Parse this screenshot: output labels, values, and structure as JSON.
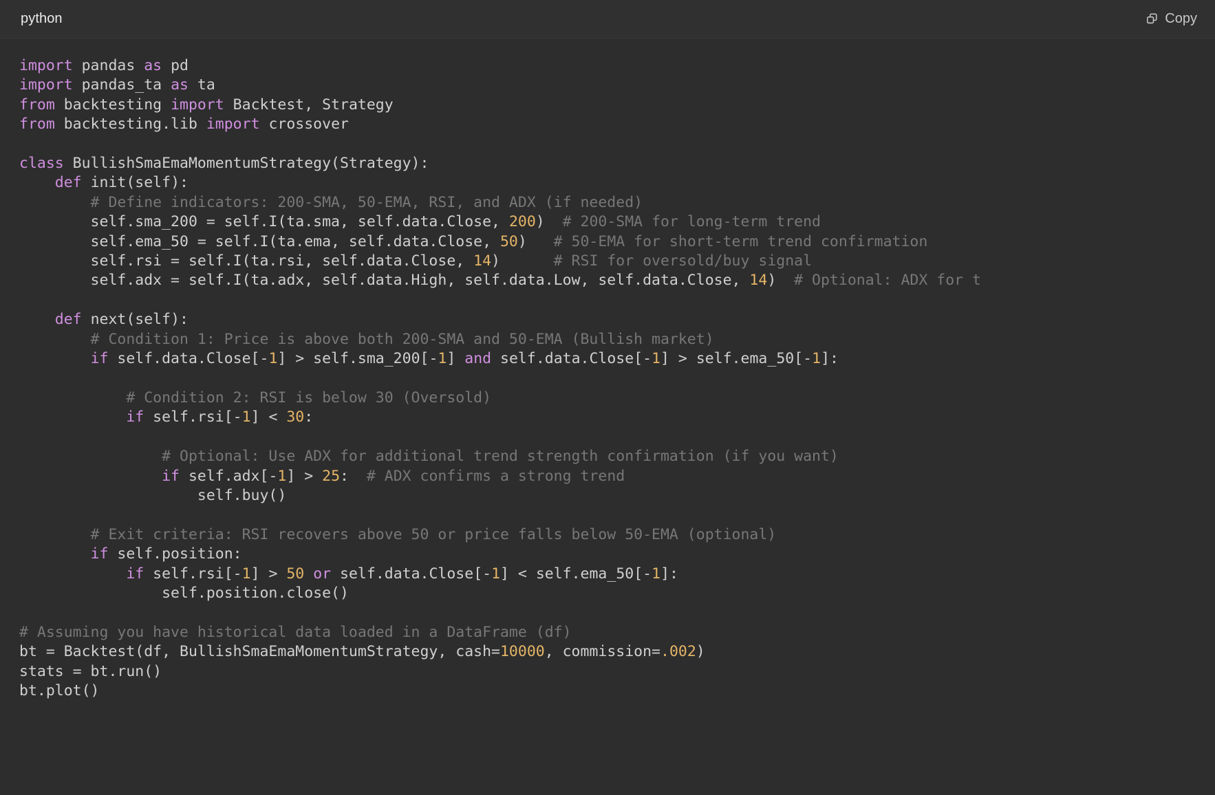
{
  "header": {
    "language_label": "python",
    "copy_label": "Copy",
    "copy_icon": "copy-icon"
  },
  "colors": {
    "background": "#2d2d2d",
    "header_background": "#303030",
    "keyword": "#d08fe0",
    "number": "#e5b567",
    "comment": "#777777",
    "identifier": "#d0d0d0",
    "label_text": "#ececec"
  },
  "code": {
    "language": "python",
    "lines": [
      [
        [
          "kw",
          "import"
        ],
        [
          "id",
          " pandas "
        ],
        [
          "kw",
          "as"
        ],
        [
          "id",
          " pd"
        ]
      ],
      [
        [
          "kw",
          "import"
        ],
        [
          "id",
          " pandas_ta "
        ],
        [
          "kw",
          "as"
        ],
        [
          "id",
          " ta"
        ]
      ],
      [
        [
          "kw",
          "from"
        ],
        [
          "id",
          " backtesting "
        ],
        [
          "kw",
          "import"
        ],
        [
          "id",
          " Backtest, Strategy"
        ]
      ],
      [
        [
          "kw",
          "from"
        ],
        [
          "id",
          " backtesting.lib "
        ],
        [
          "kw",
          "import"
        ],
        [
          "id",
          " crossover"
        ]
      ],
      [],
      [
        [
          "kw",
          "class"
        ],
        [
          "id",
          " BullishSmaEmaMomentumStrategy(Strategy):"
        ]
      ],
      [
        [
          "id",
          "    "
        ],
        [
          "kw",
          "def"
        ],
        [
          "id",
          " init(self):"
        ]
      ],
      [
        [
          "cm",
          "        # Define indicators: 200-SMA, 50-EMA, RSI, and ADX (if needed)"
        ]
      ],
      [
        [
          "id",
          "        self.sma_200 = self.I(ta.sma, self.data.Close, "
        ],
        [
          "num",
          "200"
        ],
        [
          "id",
          ")"
        ],
        [
          "cm",
          "  # 200-SMA for long-term trend"
        ]
      ],
      [
        [
          "id",
          "        self.ema_50 = self.I(ta.ema, self.data.Close, "
        ],
        [
          "num",
          "50"
        ],
        [
          "id",
          ")"
        ],
        [
          "cm",
          "   # 50-EMA for short-term trend confirmation"
        ]
      ],
      [
        [
          "id",
          "        self.rsi = self.I(ta.rsi, self.data.Close, "
        ],
        [
          "num",
          "14"
        ],
        [
          "id",
          ")"
        ],
        [
          "cm",
          "      # RSI for oversold/buy signal"
        ]
      ],
      [
        [
          "id",
          "        self.adx = self.I(ta.adx, self.data.High, self.data.Low, self.data.Close, "
        ],
        [
          "num",
          "14"
        ],
        [
          "id",
          ")"
        ],
        [
          "cm",
          "  # Optional: ADX for t"
        ]
      ],
      [],
      [
        [
          "id",
          "    "
        ],
        [
          "kw",
          "def"
        ],
        [
          "id",
          " next(self):"
        ]
      ],
      [
        [
          "cm",
          "        # Condition 1: Price is above both 200-SMA and 50-EMA (Bullish market)"
        ]
      ],
      [
        [
          "id",
          "        "
        ],
        [
          "kw",
          "if"
        ],
        [
          "id",
          " self.data.Close[-"
        ],
        [
          "num",
          "1"
        ],
        [
          "id",
          "] > self.sma_200[-"
        ],
        [
          "num",
          "1"
        ],
        [
          "id",
          "] "
        ],
        [
          "kw",
          "and"
        ],
        [
          "id",
          " self.data.Close[-"
        ],
        [
          "num",
          "1"
        ],
        [
          "id",
          "] > self.ema_50[-"
        ],
        [
          "num",
          "1"
        ],
        [
          "id",
          "]:"
        ]
      ],
      [],
      [
        [
          "cm",
          "            # Condition 2: RSI is below 30 (Oversold)"
        ]
      ],
      [
        [
          "id",
          "            "
        ],
        [
          "kw",
          "if"
        ],
        [
          "id",
          " self.rsi[-"
        ],
        [
          "num",
          "1"
        ],
        [
          "id",
          "] < "
        ],
        [
          "num",
          "30"
        ],
        [
          "id",
          ":"
        ]
      ],
      [],
      [
        [
          "cm",
          "                # Optional: Use ADX for additional trend strength confirmation (if you want)"
        ]
      ],
      [
        [
          "id",
          "                "
        ],
        [
          "kw",
          "if"
        ],
        [
          "id",
          " self.adx[-"
        ],
        [
          "num",
          "1"
        ],
        [
          "id",
          "] > "
        ],
        [
          "num",
          "25"
        ],
        [
          "id",
          ":"
        ],
        [
          "cm",
          "  # ADX confirms a strong trend"
        ]
      ],
      [
        [
          "id",
          "                    self.buy()"
        ]
      ],
      [],
      [
        [
          "cm",
          "        # Exit criteria: RSI recovers above 50 or price falls below 50-EMA (optional)"
        ]
      ],
      [
        [
          "id",
          "        "
        ],
        [
          "kw",
          "if"
        ],
        [
          "id",
          " self.position:"
        ]
      ],
      [
        [
          "id",
          "            "
        ],
        [
          "kw",
          "if"
        ],
        [
          "id",
          " self.rsi[-"
        ],
        [
          "num",
          "1"
        ],
        [
          "id",
          "] > "
        ],
        [
          "num",
          "50"
        ],
        [
          "id",
          " "
        ],
        [
          "kw",
          "or"
        ],
        [
          "id",
          " self.data.Close[-"
        ],
        [
          "num",
          "1"
        ],
        [
          "id",
          "] < self.ema_50[-"
        ],
        [
          "num",
          "1"
        ],
        [
          "id",
          "]:"
        ]
      ],
      [
        [
          "id",
          "                self.position.close()"
        ]
      ],
      [],
      [
        [
          "cm",
          "# Assuming you have historical data loaded in a DataFrame (df)"
        ]
      ],
      [
        [
          "id",
          "bt = Backtest(df, BullishSmaEmaMomentumStrategy, cash="
        ],
        [
          "num",
          "10000"
        ],
        [
          "id",
          ", commission="
        ],
        [
          "num",
          ".002"
        ],
        [
          "id",
          ")"
        ]
      ],
      [
        [
          "id",
          "stats = bt.run()"
        ]
      ],
      [
        [
          "id",
          "bt.plot()"
        ]
      ]
    ]
  }
}
